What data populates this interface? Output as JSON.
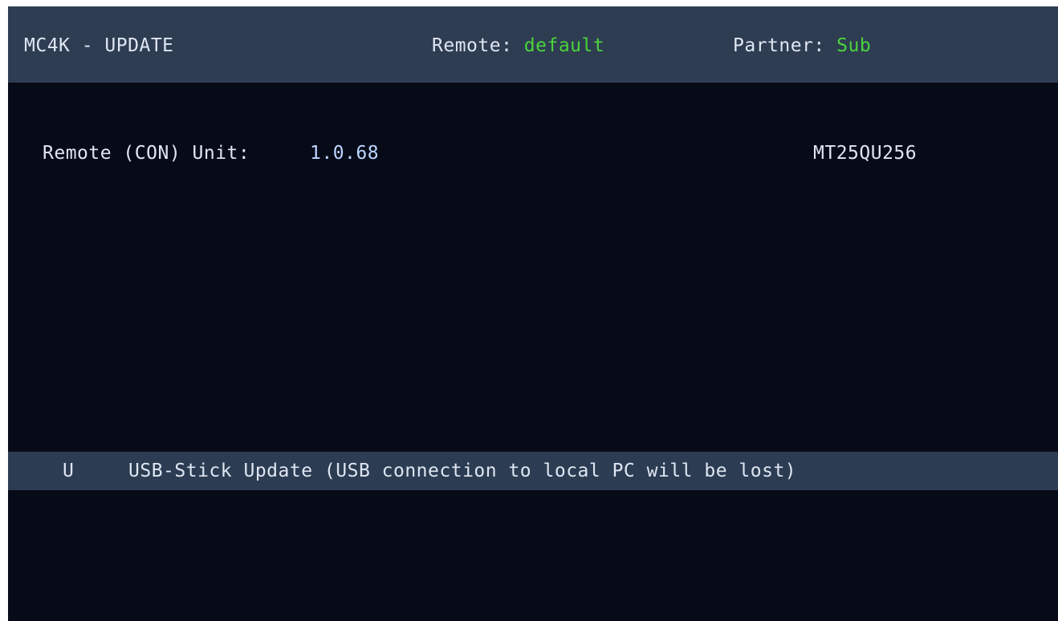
{
  "header": {
    "title": "MC4K - UPDATE",
    "remote_label": "Remote:",
    "remote_value": "default",
    "partner_label": "Partner:",
    "partner_value": "Sub"
  },
  "unit": {
    "label": "Remote (CON) Unit:",
    "version": "1.0.68",
    "chip": "MT25QU256"
  },
  "menu": {
    "items": [
      {
        "key": "U",
        "label": "USB-Stick Update (USB connection to local PC will be lost)"
      }
    ]
  },
  "colors": {
    "background": "#070a17",
    "header_bar": "#2e3d52",
    "highlight_bar": "#2c3c52",
    "accent_green": "#4cd43c",
    "version_blue": "#bcd6ff"
  }
}
